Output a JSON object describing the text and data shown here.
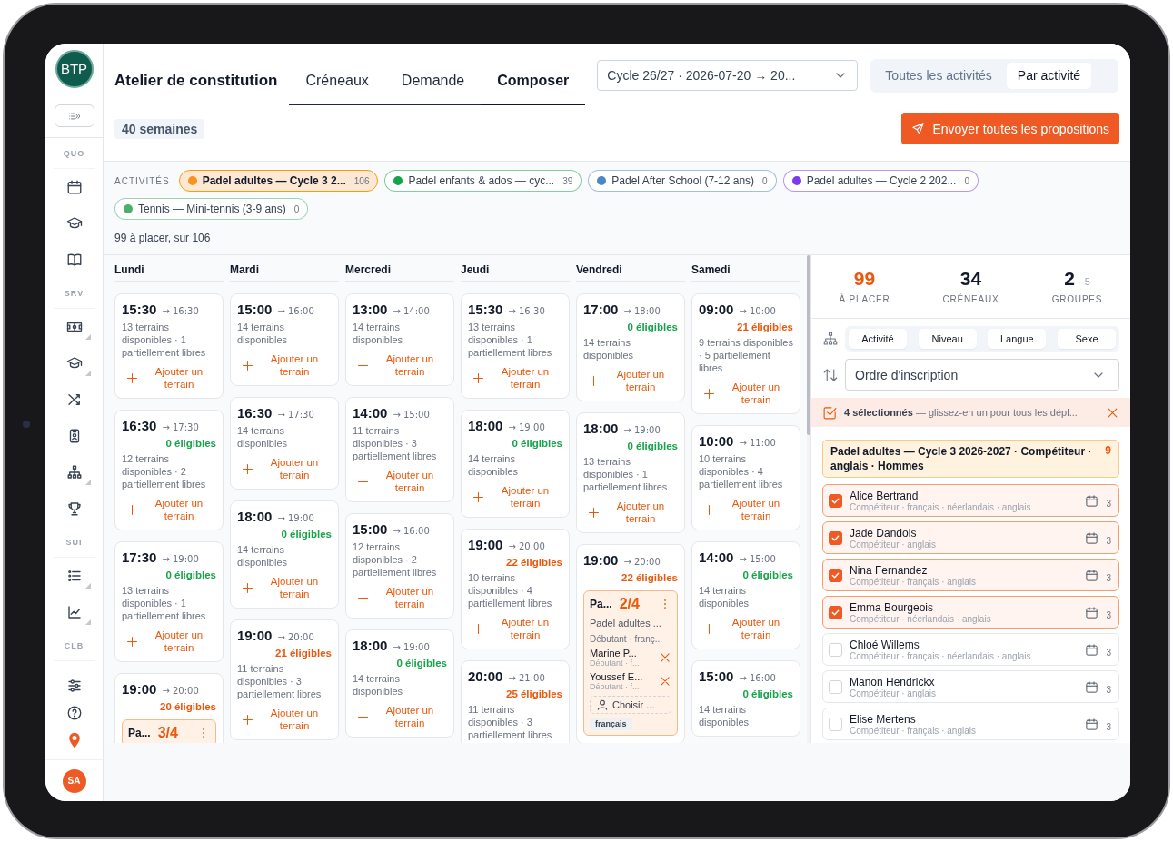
{
  "sidebar": {
    "logo": "BTP",
    "sections": [
      {
        "label": "QUO",
        "items": [
          {
            "kind": "calendar",
            "submenu": false
          },
          {
            "kind": "cap",
            "submenu": false
          },
          {
            "kind": "book",
            "submenu": false
          }
        ]
      },
      {
        "label": "SRV",
        "items": [
          {
            "kind": "field",
            "submenu": true
          },
          {
            "kind": "cap",
            "submenu": true
          },
          {
            "kind": "shuffle",
            "submenu": false
          },
          {
            "kind": "badge",
            "submenu": false
          },
          {
            "kind": "org",
            "submenu": true
          },
          {
            "kind": "trophy",
            "submenu": false
          }
        ]
      },
      {
        "label": "SUI",
        "items": [
          {
            "kind": "list",
            "submenu": true
          },
          {
            "kind": "chart",
            "submenu": true
          }
        ]
      },
      {
        "label": "CLB"
      }
    ],
    "footer": [
      {
        "kind": "sliders"
      },
      {
        "kind": "help"
      },
      {
        "kind": "pin"
      }
    ],
    "avatar": "SA"
  },
  "header": {
    "title": "Atelier de constitution",
    "tabs": [
      {
        "label": "Créneaux",
        "selected": false
      },
      {
        "label": "Demande",
        "selected": false
      },
      {
        "label": "Composer",
        "selected": true
      }
    ],
    "cycle": {
      "value": "Cycle 26/27 · 2026-07-20 → 20..."
    },
    "view": [
      {
        "label": "Toutes les activités",
        "selected": false
      },
      {
        "label": "Par activité",
        "selected": true
      }
    ],
    "weeks": "40 semaines",
    "send_button": "Envoyer toutes les propositions"
  },
  "activities": {
    "label": "ACTIVITÉS",
    "chips": [
      {
        "label": "Padel adultes — Cycle 3 2...",
        "count": "106",
        "color": "#f7931e",
        "selected": true
      },
      {
        "label": "Padel enfants & ados — cyc...",
        "count": "39",
        "color": "#16a34a",
        "selected": false
      },
      {
        "label": "Padel After School (7-12 ans)",
        "count": "0",
        "color": "#4a86c8",
        "selected": false
      },
      {
        "label": "Padel adultes — Cycle 2 202...",
        "count": "0",
        "color": "#7c3aed",
        "selected": false
      },
      {
        "label": "Tennis — Mini-tennis (3-9 ans)",
        "count": "0",
        "color": "#4caf6a",
        "selected": false
      }
    ],
    "summary": "99 à placer, sur 106"
  },
  "calendar": {
    "days": [
      {
        "name": "Lundi",
        "slots": [
          {
            "start": "15:30",
            "end": "→ 16:30",
            "courts": "13 terrains disponibles · 1 partiellement libres",
            "add": "Ajouter un terrain"
          },
          {
            "start": "16:30",
            "end": "→ 17:30",
            "eligible": "0 éligibles",
            "highlight": false,
            "courts": "12 terrains disponibles · 2 partiellement libres",
            "add": "Ajouter un terrain"
          },
          {
            "start": "17:30",
            "end": "→ 19:00",
            "eligible": "0 éligibles",
            "highlight": false,
            "courts": "13 terrains disponibles · 1 partiellement libres",
            "add": "Ajouter un terrain"
          },
          {
            "start": "19:00",
            "end": "→ 20:00",
            "eligible": "20 éligibles",
            "highlight": true,
            "group": {
              "name": "Pa...",
              "fill": "3/4"
            }
          }
        ]
      },
      {
        "name": "Mardi",
        "slots": [
          {
            "start": "15:00",
            "end": "→ 16:00",
            "courts": "14 terrains disponibles",
            "add": "Ajouter un terrain"
          },
          {
            "start": "16:30",
            "end": "→ 17:30",
            "courts": "14 terrains disponibles",
            "add": "Ajouter un terrain"
          },
          {
            "start": "18:00",
            "end": "→ 19:00",
            "eligible": "0 éligibles",
            "highlight": false,
            "courts": "14 terrains disponibles",
            "add": "Ajouter un terrain"
          },
          {
            "start": "19:00",
            "end": "→ 20:00",
            "eligible": "21 éligibles",
            "highlight": true,
            "courts": "11 terrains disponibles · 3 partiellement libres",
            "add": "Ajouter un terrain"
          }
        ]
      },
      {
        "name": "Mercredi",
        "slots": [
          {
            "start": "13:00",
            "end": "→ 14:00",
            "courts": "14 terrains disponibles",
            "add": "Ajouter un terrain"
          },
          {
            "start": "14:00",
            "end": "→ 15:00",
            "courts": "11 terrains disponibles · 3 partiellement libres",
            "add": "Ajouter un terrain"
          },
          {
            "start": "15:00",
            "end": "→ 16:00",
            "courts": "12 terrains disponibles · 2 partiellement libres",
            "add": "Ajouter un terrain"
          },
          {
            "start": "18:00",
            "end": "→ 19:00",
            "eligible": "0 éligibles",
            "highlight": false,
            "courts": "14 terrains disponibles",
            "add": "Ajouter un terrain"
          }
        ]
      },
      {
        "name": "Jeudi",
        "slots": [
          {
            "start": "15:30",
            "end": "→ 16:30",
            "courts": "13 terrains disponibles · 1 partiellement libres",
            "add": "Ajouter un terrain"
          },
          {
            "start": "18:00",
            "end": "→ 19:00",
            "eligible": "0 éligibles",
            "highlight": false,
            "courts": "14 terrains disponibles",
            "add": "Ajouter un terrain"
          },
          {
            "start": "19:00",
            "end": "→ 20:00",
            "eligible": "22 éligibles",
            "highlight": true,
            "courts": "10 terrains disponibles · 4 partiellement libres",
            "add": "Ajouter un terrain"
          },
          {
            "start": "20:00",
            "end": "→ 21:00",
            "eligible": "25 éligibles",
            "highlight": true,
            "courts": "11 terrains disponibles · 3 partiellement libres"
          }
        ]
      },
      {
        "name": "Vendredi",
        "slots": [
          {
            "start": "17:00",
            "end": "→ 18:00",
            "eligible": "0 éligibles",
            "highlight": false,
            "courts": "14 terrains disponibles",
            "add": "Ajouter un terrain"
          },
          {
            "start": "18:00",
            "end": "→ 19:00",
            "eligible": "0 éligibles",
            "highlight": false,
            "courts": "13 terrains disponibles · 1 partiellement libres",
            "add": "Ajouter un terrain"
          },
          {
            "start": "19:00",
            "end": "→ 20:00",
            "eligible": "22 éligibles",
            "highlight": true,
            "group": {
              "name": "Pa...",
              "fill": "2/4",
              "activity": "Padel adultes ...",
              "meta": "Débutant · franç...",
              "members": [
                {
                  "name": "Marine P...",
                  "meta": "Débutant · f..."
                },
                {
                  "name": "Youssef E...",
                  "meta": "Débutant · f..."
                }
              ],
              "choose": "Choisir ...",
              "tags": [
                "français"
              ]
            }
          }
        ]
      },
      {
        "name": "Samedi",
        "slots": [
          {
            "start": "09:00",
            "end": "→ 10:00",
            "eligible": "21 éligibles",
            "highlight": true,
            "courts": "9 terrains disponibles · 5 partiellement libres",
            "add": "Ajouter un terrain"
          },
          {
            "start": "10:00",
            "end": "→ 11:00",
            "courts": "10 terrains disponibles · 4 partiellement libres",
            "add": "Ajouter un terrain"
          },
          {
            "start": "14:00",
            "end": "→ 15:00",
            "eligible": "0 éligibles",
            "highlight": false,
            "courts": "14 terrains disponibles",
            "add": "Ajouter un terrain"
          },
          {
            "start": "15:00",
            "end": "→ 16:00",
            "eligible": "0 éligibles",
            "highlight": false,
            "courts": "14 terrains disponibles"
          }
        ]
      }
    ]
  },
  "panel": {
    "stats": [
      {
        "value": "99",
        "label": "À PLACER",
        "accent": true
      },
      {
        "value": "34",
        "label": "CRÉNEAUX",
        "accent": false
      },
      {
        "value": "2",
        "extra": "· 5",
        "label": "GROUPES",
        "accent": false
      }
    ],
    "group_by": [
      {
        "label": "Activité",
        "selected": true
      },
      {
        "label": "Niveau",
        "selected": true
      },
      {
        "label": "Langue",
        "selected": true
      },
      {
        "label": "Sexe",
        "selected": true
      }
    ],
    "sort": {
      "value": "Ordre d'inscription"
    },
    "selection": "**4 sélectionnés** — glissez-en un pour tous les dépl...",
    "group": {
      "title": "Padel adultes — Cycle 3 2026-2027 · Compétiteur · anglais · Hommes",
      "count": "9"
    },
    "people": [
      {
        "name": "Alice Bertrand",
        "meta": "Compétiteur · français · néerlandais · anglais",
        "slots": "3",
        "checked": true
      },
      {
        "name": "Jade Dandois",
        "meta": "Compétiteur · anglais",
        "slots": "3",
        "checked": true
      },
      {
        "name": "Nina Fernandez",
        "meta": "Compétiteur · français · anglais",
        "slots": "3",
        "checked": true
      },
      {
        "name": "Emma Bourgeois",
        "meta": "Compétiteur · néerlandais · anglais",
        "slots": "3",
        "checked": true
      },
      {
        "name": "Chloé Willems",
        "meta": "Compétiteur · français · néerlandais · anglais",
        "slots": "3",
        "checked": false
      },
      {
        "name": "Manon Hendrickx",
        "meta": "Compétiteur · anglais",
        "slots": "3",
        "checked": false
      },
      {
        "name": "Elise Mertens",
        "meta": "Compétiteur · français · anglais",
        "slots": "3",
        "checked": false
      }
    ]
  }
}
